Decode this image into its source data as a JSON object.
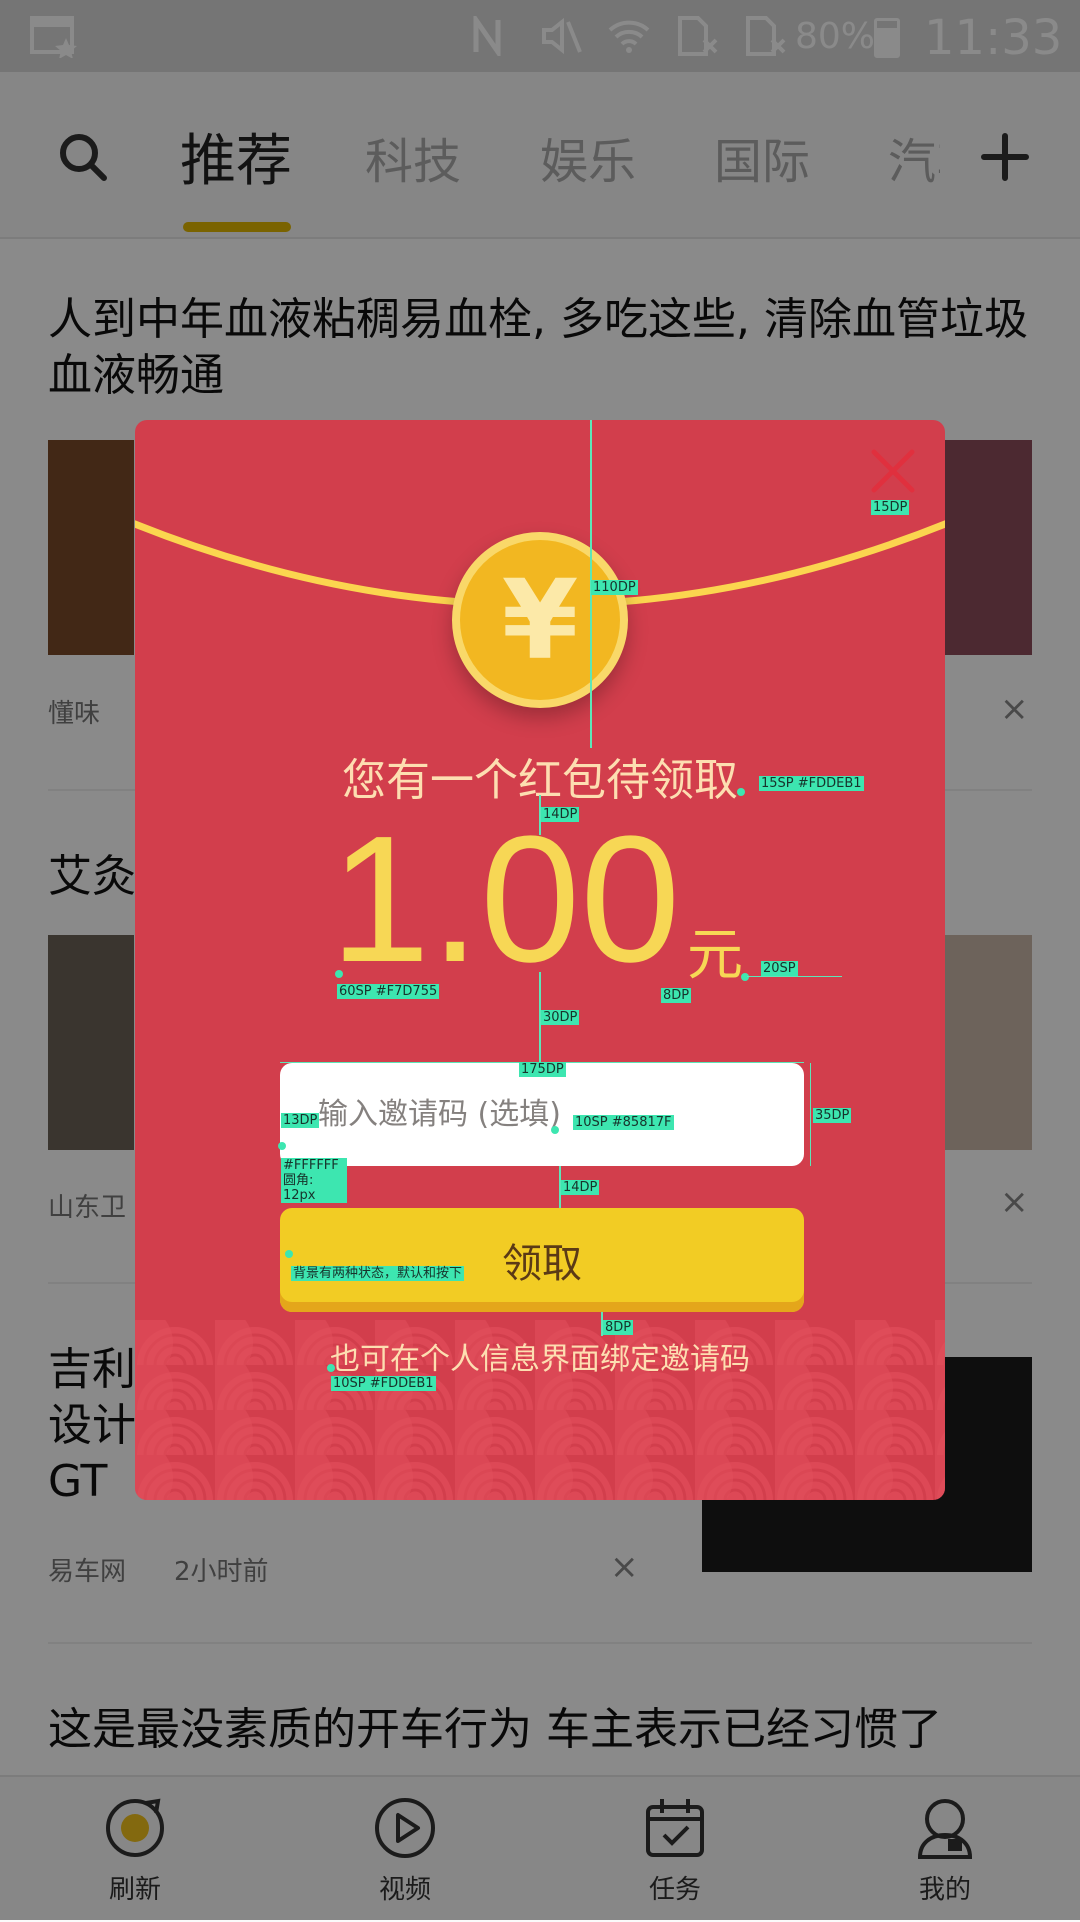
{
  "status_bar": {
    "battery": "80%",
    "time": "11:33"
  },
  "nav": {
    "tabs": [
      "推荐",
      "科技",
      "娱乐",
      "国际",
      "汽车"
    ],
    "active_tab": "推荐",
    "accent_color": "#e1b800"
  },
  "feed": {
    "items": [
      {
        "title": "人到中年血液粘稠易血栓, 多吃这些, 清除血管垃圾血液畅通",
        "source": "懂味"
      },
      {
        "title": "艾灸",
        "source": "山东卫"
      },
      {
        "title": "吉利设计GT",
        "source": "易车网",
        "time": "2小时前"
      },
      {
        "title": "这是最没素质的开车行为 车主表示已经习惯了"
      }
    ],
    "dismiss_glyph": "×"
  },
  "bottom_nav": {
    "items": [
      {
        "label": "刷新",
        "icon": "refresh-icon"
      },
      {
        "label": "视频",
        "icon": "video-icon"
      },
      {
        "label": "任务",
        "icon": "task-icon"
      },
      {
        "label": "我的",
        "icon": "profile-icon"
      }
    ]
  },
  "red_packet": {
    "coin_symbol": "¥",
    "title": "您有一个红包待领取",
    "amount": "1.00",
    "unit": "元",
    "input_placeholder": "输入邀请码 (选填)",
    "button_label": "领取",
    "hint": "也可在个人信息界面绑定邀请码",
    "colors": {
      "background": "#d23e4c",
      "title": "#FDDEB1",
      "amount": "#F7D755",
      "placeholder": "#85817F",
      "input_bg": "#FFFFFF",
      "button": "#f2cc24"
    }
  },
  "annotations": {
    "close_size": "15DP",
    "coin_gap": "110DP",
    "title_spec": "15SP #FDDEB1",
    "title_gap": "14DP",
    "amount_spec": "60SP #F7D755",
    "unit_gap": "8DP",
    "unit_spec": "20SP",
    "amount_gap": "30DP",
    "input_width": "175DP",
    "input_padding": "13DP",
    "placeholder_spec": "10SP #85817F",
    "input_height": "35DP",
    "input_bg_spec": "#FFFFFF",
    "input_radius": "圆角: 12px",
    "input_gap": "14DP",
    "button_note": "背景有两种状态，默认和按下",
    "hint_gap": "8DP",
    "hint_spec": "10SP #FDDEB1"
  }
}
